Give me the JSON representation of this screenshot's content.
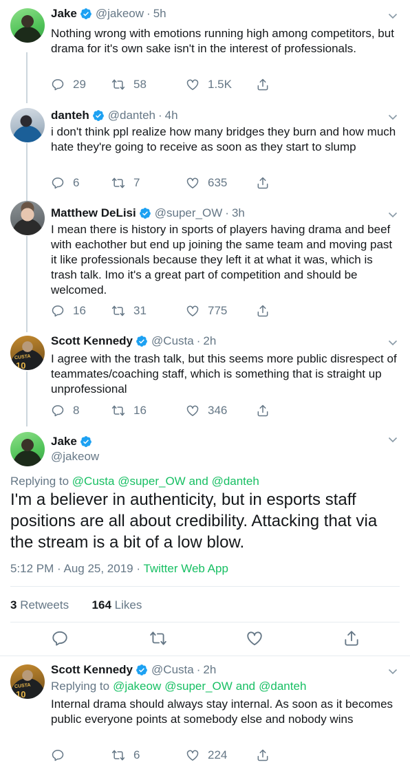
{
  "tweets": [
    {
      "name": "Jake",
      "handle": "@jakeow",
      "time": "5h",
      "text": "Nothing wrong with emotions running high among competitors, but drama for it's own sake isn't in the interest of professionals.",
      "replies": "29",
      "retweets": "58",
      "likes": "1.5K",
      "avatar": "green"
    },
    {
      "name": "danteh",
      "handle": "@danteh",
      "time": "4h",
      "text": "i don't think ppl realize how many bridges they burn and how much hate they're going to receive as soon as they start to slump",
      "replies": "6",
      "retweets": "7",
      "likes": "635",
      "avatar": "blue"
    },
    {
      "name": "Matthew DeLisi",
      "handle": "@super_OW",
      "time": "3h",
      "text": "I mean there is history in sports of players having drama and beef with eachother but end up joining the same team and moving past it like professionals because they left it at what it was, which is trash talk. Imo it's a great part of competition and should be welcomed.",
      "replies": "16",
      "retweets": "31",
      "likes": "775",
      "avatar": "gray"
    },
    {
      "name": "Scott Kennedy",
      "handle": "@Custa",
      "time": "2h",
      "text": "I agree with the trash talk, but this seems more public disrespect of teammates/coaching staff, which is something that is straight up unprofessional",
      "replies": "8",
      "retweets": "16",
      "likes": "346",
      "avatar": "custa"
    }
  ],
  "focus": {
    "name": "Jake",
    "handle": "@jakeow",
    "replying_prefix": "Replying to",
    "replying_to_1": "@Custa",
    "replying_to_2": "@super_OW",
    "replying_and": "and",
    "replying_to_3": "@danteh",
    "text": "I'm a believer in authenticity, but in esports staff positions are all about credibility. Attacking that via the stream is a bit of a low blow.",
    "timestamp": "5:12 PM · Aug 25, 2019 ·",
    "app": "Twitter Web App",
    "retweet_count": "3",
    "retweet_label": "Retweets",
    "like_count": "164",
    "like_label": "Likes"
  },
  "reply": {
    "name": "Scott Kennedy",
    "handle": "@Custa",
    "time": "2h",
    "replying_prefix": "Replying to",
    "replying_to_1": "@jakeow",
    "replying_to_2": "@super_OW",
    "replying_and": "and",
    "replying_to_3": "@danteh",
    "text": "Internal drama should always stay internal. As soon as it becomes public everyone points at somebody else and nobody wins",
    "retweets": "6",
    "likes": "224"
  },
  "custa_avatar_text": "CUSTA",
  "custa_avatar_number": "10",
  "colors": {
    "link": "#17bf63",
    "verified": "#1da1f2",
    "secondary_text": "#657786",
    "divider": "#e6ecf0"
  }
}
